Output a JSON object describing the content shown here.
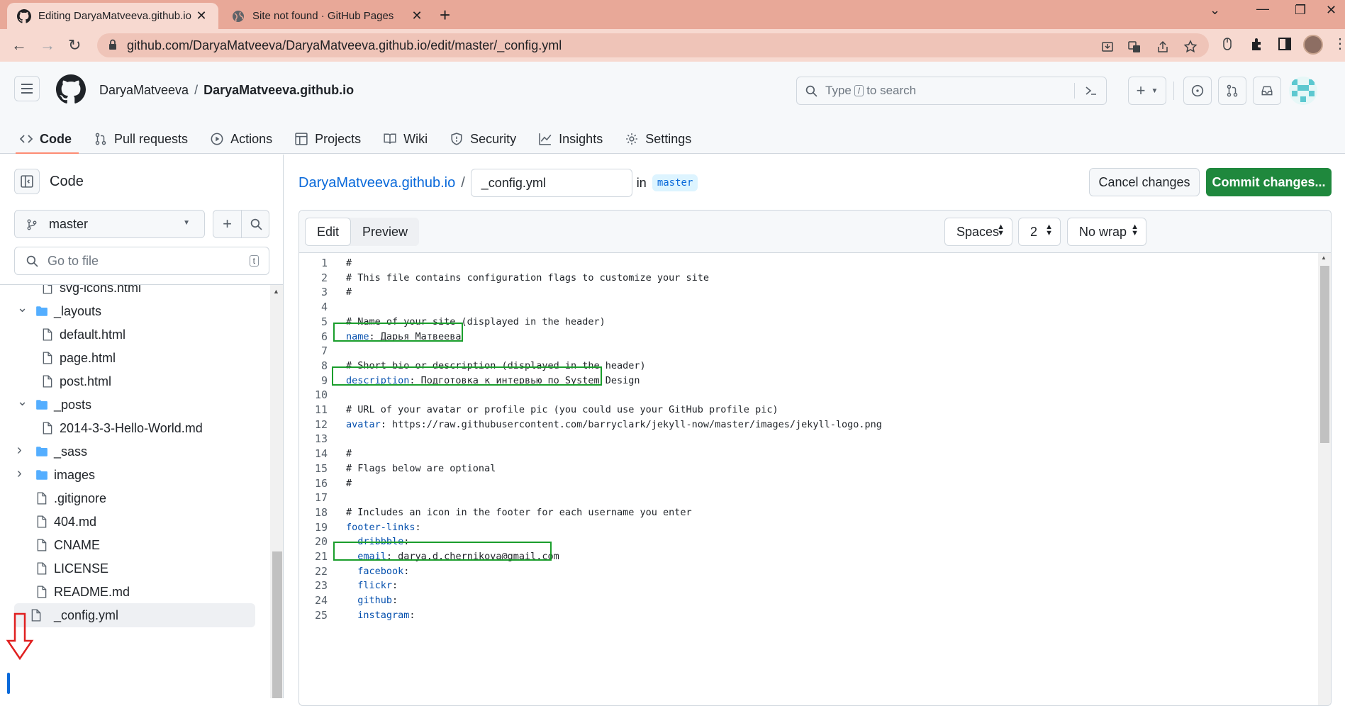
{
  "browser": {
    "tabs": [
      {
        "title": "Editing DaryaMatveeva.github.io",
        "active": true
      },
      {
        "title": "Site not found · GitHub Pages",
        "active": false
      }
    ],
    "url": "github.com/DaryaMatveeva/DaryaMatveeva.github.io/edit/master/_config.yml"
  },
  "header": {
    "owner": "DaryaMatveeva",
    "separator": "/",
    "repo": "DaryaMatveeva.github.io",
    "search_prefix": "Type",
    "search_key": "/",
    "search_suffix": "to search",
    "add_symbol": "+"
  },
  "repo_nav": [
    {
      "label": "Code",
      "icon": "code-icon",
      "selected": true
    },
    {
      "label": "Pull requests",
      "icon": "pull-request-icon"
    },
    {
      "label": "Actions",
      "icon": "play-icon"
    },
    {
      "label": "Projects",
      "icon": "table-icon"
    },
    {
      "label": "Wiki",
      "icon": "book-icon"
    },
    {
      "label": "Security",
      "icon": "shield-icon"
    },
    {
      "label": "Insights",
      "icon": "graph-icon"
    },
    {
      "label": "Settings",
      "icon": "gear-icon"
    }
  ],
  "sidebar": {
    "title": "Code",
    "branch": "master",
    "goto_placeholder": "Go to file",
    "goto_shortcut": "t",
    "tree": [
      {
        "label": "svg-icons.html",
        "type": "file",
        "depth": 1
      },
      {
        "label": "_layouts",
        "type": "folder",
        "open": true,
        "depth": 0
      },
      {
        "label": "default.html",
        "type": "file",
        "depth": 1
      },
      {
        "label": "page.html",
        "type": "file",
        "depth": 1
      },
      {
        "label": "post.html",
        "type": "file",
        "depth": 1
      },
      {
        "label": "_posts",
        "type": "folder",
        "open": true,
        "depth": 0
      },
      {
        "label": "2014-3-3-Hello-World.md",
        "type": "file",
        "depth": 1
      },
      {
        "label": "_sass",
        "type": "folder",
        "open": false,
        "depth": 0
      },
      {
        "label": "images",
        "type": "folder",
        "open": false,
        "depth": 0
      },
      {
        "label": ".gitignore",
        "type": "file",
        "depth": 0
      },
      {
        "label": "404.md",
        "type": "file",
        "depth": 0
      },
      {
        "label": "CNAME",
        "type": "file",
        "depth": 0
      },
      {
        "label": "LICENSE",
        "type": "file",
        "depth": 0
      },
      {
        "label": "README.md",
        "type": "file",
        "depth": 0
      },
      {
        "label": "_config.yml",
        "type": "file",
        "depth": 0,
        "current": true
      }
    ]
  },
  "editor": {
    "repo_link": "DaryaMatveeva.github.io",
    "slash": "/",
    "filename": "_config.yml",
    "in_label": "in",
    "branch": "master",
    "cancel_label": "Cancel changes",
    "commit_label": "Commit changes...",
    "tab_edit": "Edit",
    "tab_preview": "Preview",
    "indent_mode": "Spaces",
    "indent_size": "2",
    "wrap_mode": "No wrap",
    "lines": [
      {
        "n": "1",
        "key": "",
        "rest": "#"
      },
      {
        "n": "2",
        "key": "",
        "rest": "# This file contains configuration flags to customize your site"
      },
      {
        "n": "3",
        "key": "",
        "rest": "#"
      },
      {
        "n": "4",
        "key": "",
        "rest": ""
      },
      {
        "n": "5",
        "key": "",
        "rest": "# Name of your site (displayed in the header)"
      },
      {
        "n": "6",
        "key": "name",
        "rest": ": Дарья Матвеева"
      },
      {
        "n": "7",
        "key": "",
        "rest": ""
      },
      {
        "n": "8",
        "key": "",
        "rest": "# Short bio or description (displayed in the header)"
      },
      {
        "n": "9",
        "key": "description",
        "rest": ": Подготовка к интервью по System Design"
      },
      {
        "n": "10",
        "key": "",
        "rest": ""
      },
      {
        "n": "11",
        "key": "",
        "rest": "# URL of your avatar or profile pic (you could use your GitHub profile pic)"
      },
      {
        "n": "12",
        "key": "avatar",
        "rest": ": https://raw.githubusercontent.com/barryclark/jekyll-now/master/images/jekyll-logo.png"
      },
      {
        "n": "13",
        "key": "",
        "rest": ""
      },
      {
        "n": "14",
        "key": "",
        "rest": "#"
      },
      {
        "n": "15",
        "key": "",
        "rest": "# Flags below are optional"
      },
      {
        "n": "16",
        "key": "",
        "rest": "#"
      },
      {
        "n": "17",
        "key": "",
        "rest": ""
      },
      {
        "n": "18",
        "key": "",
        "rest": "# Includes an icon in the footer for each username you enter"
      },
      {
        "n": "19",
        "key": "footer-links",
        "rest": ":"
      },
      {
        "n": "20",
        "key": "  dribbble",
        "rest": ":"
      },
      {
        "n": "21",
        "key": "  email",
        "rest": ": darya.d.chernikova@gmail.com"
      },
      {
        "n": "22",
        "key": "  facebook",
        "rest": ":"
      },
      {
        "n": "23",
        "key": "  flickr",
        "rest": ":"
      },
      {
        "n": "24",
        "key": "  github",
        "rest": ":"
      },
      {
        "n": "25",
        "key": "  instagram",
        "rest": ":"
      }
    ]
  },
  "colors": {
    "accent": "#0969da",
    "commit_green": "#1f883d",
    "highlight_box": "#1a9e2c",
    "annotation_arrow": "#e02020",
    "tab_strip": "#e8a898"
  }
}
